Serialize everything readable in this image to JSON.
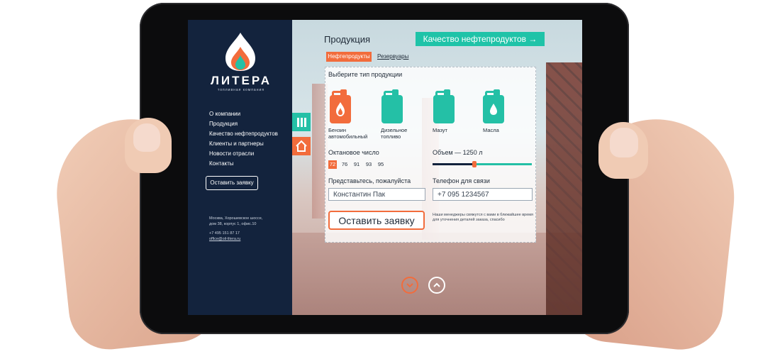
{
  "sidebar": {
    "logo_title": "ЛИТЕРА",
    "logo_subtitle": "топливная компания",
    "nav": [
      {
        "label": "О компании"
      },
      {
        "label": "Продукция"
      },
      {
        "label": "Качество нефтепродуктов"
      },
      {
        "label": "Клиенты и партнеры"
      },
      {
        "label": "Новости отрасли"
      },
      {
        "label": "Контакты"
      }
    ],
    "cta_label": "Оставить заявку",
    "address_line1": "Москва, Хорошевское шоссе,",
    "address_line2": "дом 38, корпус 1, офис.10",
    "phone": "+7 495 151 87 17",
    "email": "office@oil-litera.ru"
  },
  "header": {
    "title": "Продукция",
    "quality_link": "Качество нефтепродуктов →"
  },
  "tabs": [
    {
      "label": "Нефтепродукты",
      "active": true
    },
    {
      "label": "Резервуары",
      "active": false
    }
  ],
  "form": {
    "product_heading": "Выберите тип продукции",
    "products": [
      {
        "line1": "Бензин",
        "line2": "автомобильный",
        "color": "#f26c3c",
        "icon": "flame-icon"
      },
      {
        "line1": "Дизельное",
        "line2": "топливо",
        "color": "#24c0a6",
        "icon": ""
      },
      {
        "line1": "Мазут",
        "line2": "",
        "color": "#24c0a6",
        "icon": ""
      },
      {
        "line1": "Масла",
        "line2": "",
        "color": "#24c0a6",
        "icon": "drop-icon"
      }
    ],
    "octane_label": "Октановое число",
    "octane_values": [
      "72",
      "76",
      "91",
      "93",
      "95"
    ],
    "octane_selected": "72",
    "volume_label": "Объем — 1250 л",
    "volume_fraction": 0.42,
    "name_label": "Представьтесь, пожалуйста",
    "name_value": "Константин Пак",
    "phone_label": "Телефон для связи",
    "phone_value": "+7 095 1234567",
    "submit_label": "Оставить заявку",
    "note": "Наши менеджеры свяжутся с вами в ближайшее время для уточнения деталей заказа, спасибо"
  },
  "colors": {
    "accent_orange": "#f26c3c",
    "accent_teal": "#1fc3a8",
    "sidebar_navy": "#13233d"
  }
}
